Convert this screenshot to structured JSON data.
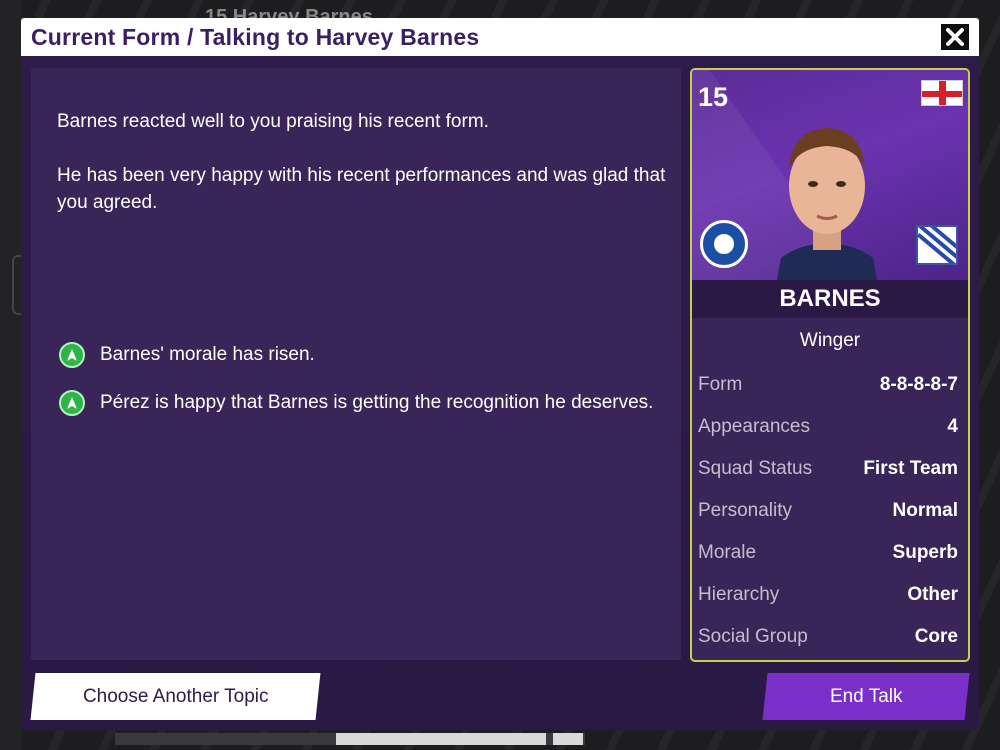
{
  "background": {
    "header_text": "15  Harvey Barnes"
  },
  "dialog": {
    "title": "Current Form / Talking to Harvey Barnes",
    "close_icon": "close-icon"
  },
  "message": {
    "paragraphs": [
      "Barnes reacted well to you praising his recent form.",
      "He has been very happy with his recent performances and was glad that you agreed."
    ],
    "outcomes": [
      {
        "icon": "up-arrow-icon",
        "text": "Barnes' morale has risen."
      },
      {
        "icon": "up-arrow-icon",
        "text": "Pérez is happy that Barnes is getting the recognition he deserves."
      }
    ]
  },
  "player": {
    "number": "15",
    "name": "BARNES",
    "position": "Winger",
    "nation_flag": "england-flag-icon",
    "club_badge": "leicester-city-badge-icon",
    "stats": [
      {
        "label": "Form",
        "value": "8-8-8-8-7"
      },
      {
        "label": "Appearances",
        "value": "4"
      },
      {
        "label": "Squad Status",
        "value": "First Team"
      },
      {
        "label": "Personality",
        "value": "Normal"
      },
      {
        "label": "Morale",
        "value": "Superb"
      },
      {
        "label": "Hierarchy",
        "value": "Other"
      },
      {
        "label": "Social Group",
        "value": "Core"
      }
    ]
  },
  "buttons": {
    "choose_another": "Choose Another Topic",
    "end_talk": "End Talk"
  },
  "colors": {
    "accent": "#7a30c8",
    "title_text": "#3b1e63",
    "card_border": "#c9cf4d",
    "positive": "#2eb54a"
  }
}
